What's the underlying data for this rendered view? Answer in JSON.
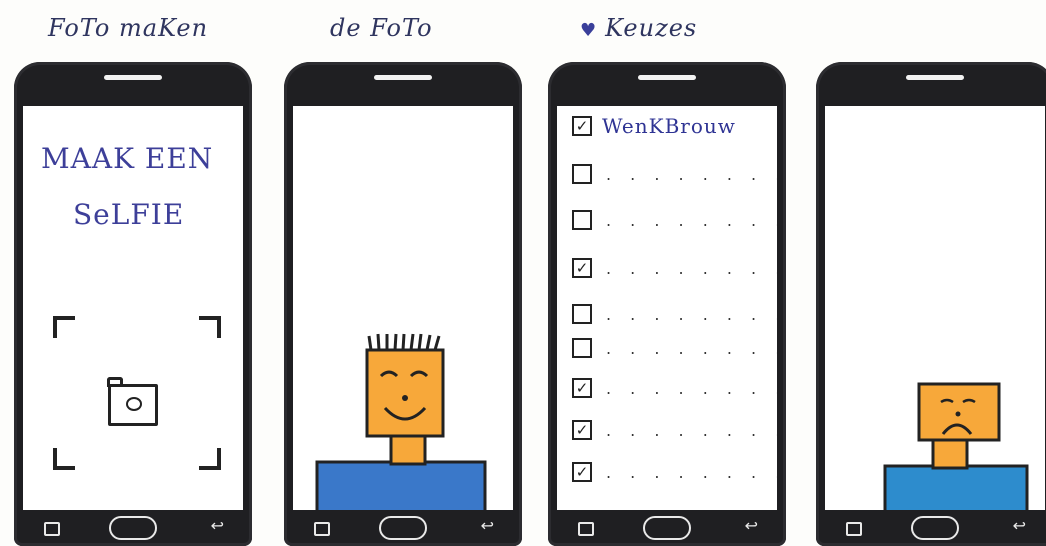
{
  "captions": [
    "FoTo maKen",
    "de FoTo",
    "Keuzes"
  ],
  "screen1": {
    "line1": "MAAK EEN",
    "line2": "SeLFIE"
  },
  "screen3": {
    "first_label": "WenKBrouw",
    "checkboxes": [
      {
        "checked": true
      },
      {
        "checked": false
      },
      {
        "checked": false
      },
      {
        "checked": true
      },
      {
        "checked": false
      },
      {
        "checked": false
      },
      {
        "checked": true
      },
      {
        "checked": true
      },
      {
        "checked": true
      }
    ],
    "dots": ". . . . . . . . ."
  },
  "colors": {
    "face": "#f7a83a",
    "shirt": "#3a78c9",
    "ink": "#222222"
  },
  "icons": [
    "camera-icon",
    "recent-apps-icon",
    "home-button",
    "back-icon",
    "check-icon",
    "heart-icon"
  ]
}
